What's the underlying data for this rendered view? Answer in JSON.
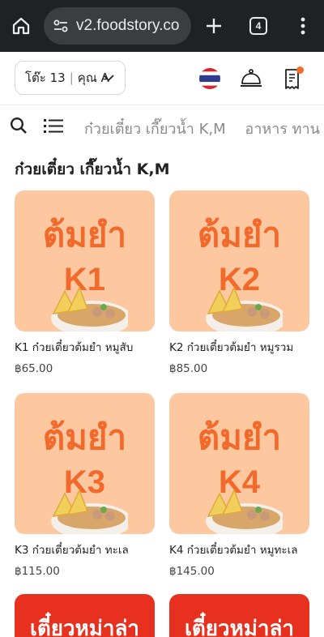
{
  "browser": {
    "url": "v2.foodstory.co",
    "tab_count": "4"
  },
  "header": {
    "table_label": "โต๊ะ 13",
    "customer_label": "คุณ A",
    "language_flag": "thailand-flag",
    "colors": {
      "accent": "#f26a2e"
    }
  },
  "categories": {
    "tabs": [
      "ก๋วยเตี๋ยว เกี๊ยวน้ำ K,M",
      "อาหาร ทาน"
    ]
  },
  "section": {
    "title": "ก๋วยเตี๋ยว เกี๊ยวน้ำ K,M"
  },
  "menu_items": [
    {
      "image_line1": "ต้มยำ",
      "image_line2": "K1",
      "name": "K1 ก๋วยเตี๋ยวต้มยำ หมูสับ",
      "price": "฿65.00"
    },
    {
      "image_line1": "ต้มยำ",
      "image_line2": "K2",
      "name": "K2 ก๋วยเตี๋ยวต้มยำ หมูรวม",
      "price": "฿85.00"
    },
    {
      "image_line1": "ต้มยำ",
      "image_line2": "K3",
      "name": "K3 ก๋วยเตี๋ยวต้มยำ ทะเล",
      "price": "฿115.00"
    },
    {
      "image_line1": "ต้มยำ",
      "image_line2": "K4",
      "name": "K4 ก๋วยเตี๋ยวต้มยำ หมูทะเล",
      "price": "฿145.00"
    }
  ],
  "partial_items": [
    {
      "image_text": "เตี๋ยวหม่าล่า"
    },
    {
      "image_text": "เตี๋ยวหม่าล่า"
    }
  ]
}
